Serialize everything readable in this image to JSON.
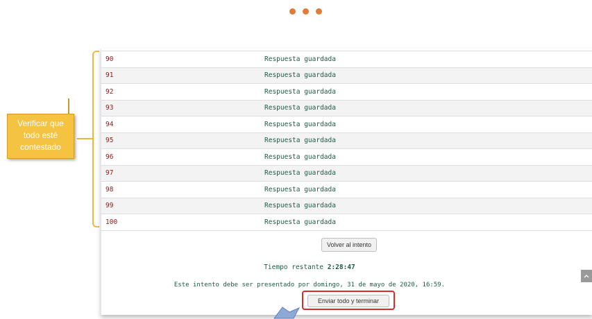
{
  "header": {
    "dots": [
      "dot",
      "dot",
      "dot"
    ]
  },
  "summary": {
    "rows": [
      {
        "number": "90",
        "status": "Respuesta guardada"
      },
      {
        "number": "91",
        "status": "Respuesta guardada"
      },
      {
        "number": "92",
        "status": "Respuesta guardada"
      },
      {
        "number": "93",
        "status": "Respuesta guardada"
      },
      {
        "number": "94",
        "status": "Respuesta guardada"
      },
      {
        "number": "95",
        "status": "Respuesta guardada"
      },
      {
        "number": "96",
        "status": "Respuesta guardada"
      },
      {
        "number": "97",
        "status": "Respuesta guardada"
      },
      {
        "number": "98",
        "status": "Respuesta guardada"
      },
      {
        "number": "99",
        "status": "Respuesta guardada"
      },
      {
        "number": "100",
        "status": "Respuesta guardada"
      }
    ],
    "return_button": "Volver al intento",
    "time_label": "Tiempo restante",
    "time_value": "2:28:47",
    "deadline_text": "Este intento debe ser presentado por domingo, 31 de mayo de 2020, 16:59.",
    "submit_button": "Enviar todo y terminar"
  },
  "annotation": {
    "callout_text": "Verificar que\ntodo esté\ncontestado"
  },
  "scroll_top_icon": "chevron-up-icon",
  "colors": {
    "question_number": "#8b1a1a",
    "status_text": "#1e5a46",
    "callout_bg": "#f5c342",
    "bracket": "#f0b83b",
    "highlight": "#d62b2b",
    "dots": "#e07b39"
  }
}
